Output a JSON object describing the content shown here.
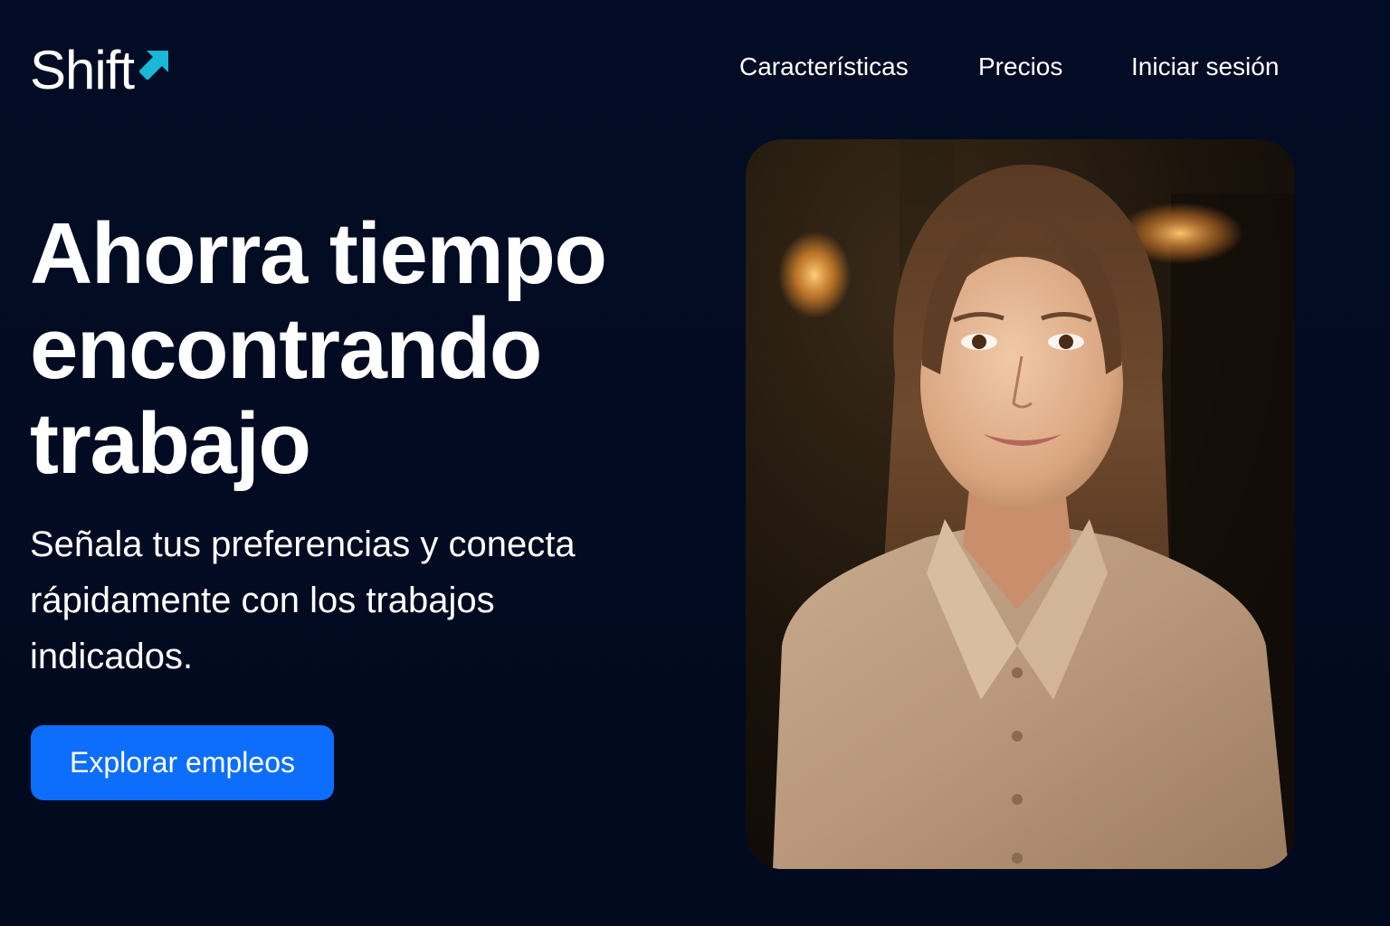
{
  "header": {
    "logo_text": "Shift",
    "logo_icon": "arrow-up-right-icon",
    "nav": {
      "features": "Características",
      "pricing": "Precios",
      "login": "Iniciar sesión"
    }
  },
  "hero": {
    "title_lines": [
      "Ahorra tiempo",
      "encontrando",
      "trabajo"
    ],
    "subtitle_lines": [
      "Señala tus preferencias y conecta",
      "rápidamente con los trabajos",
      "indicados."
    ],
    "cta_label": "Explorar empleos"
  },
  "colors": {
    "background": "#020b22",
    "accent": "#0d6efd",
    "logo_arrow": "#18b8d8",
    "text": "#ffffff"
  }
}
